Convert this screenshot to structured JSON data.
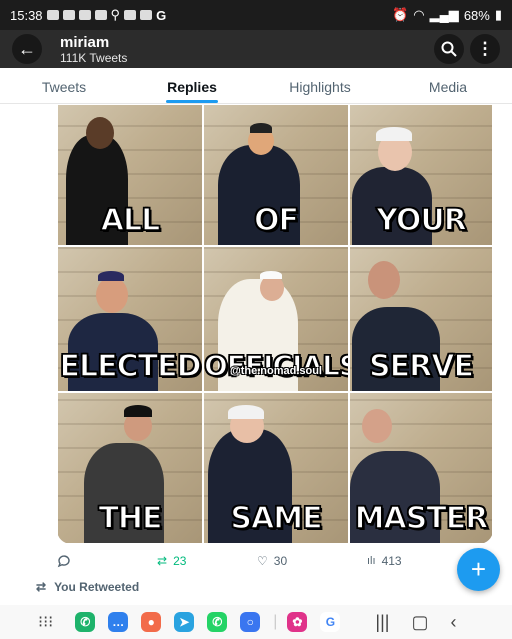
{
  "status_bar": {
    "time": "15:38",
    "battery": "68%"
  },
  "header": {
    "title": "miriam",
    "subtitle": "111K Tweets"
  },
  "tabs": [
    {
      "label": "Tweets",
      "active": false
    },
    {
      "label": "Replies",
      "active": true
    },
    {
      "label": "Highlights",
      "active": false
    },
    {
      "label": "Media",
      "active": false
    }
  ],
  "meme": {
    "words": [
      "ALL",
      "OF",
      "YOUR",
      "ELECTED",
      "OFFICIALS",
      "SERVE",
      "THE",
      "SAME",
      "MASTER"
    ],
    "watermark": "@the.nomad.soul"
  },
  "actions": {
    "replies": "",
    "retweets": "23",
    "likes": "30",
    "views": "413"
  },
  "retweeted_label": "You Retweeted",
  "colors": {
    "accent": "#1d9bf0",
    "retweet": "#00ba7c",
    "header_bg": "#2c2c2c"
  }
}
